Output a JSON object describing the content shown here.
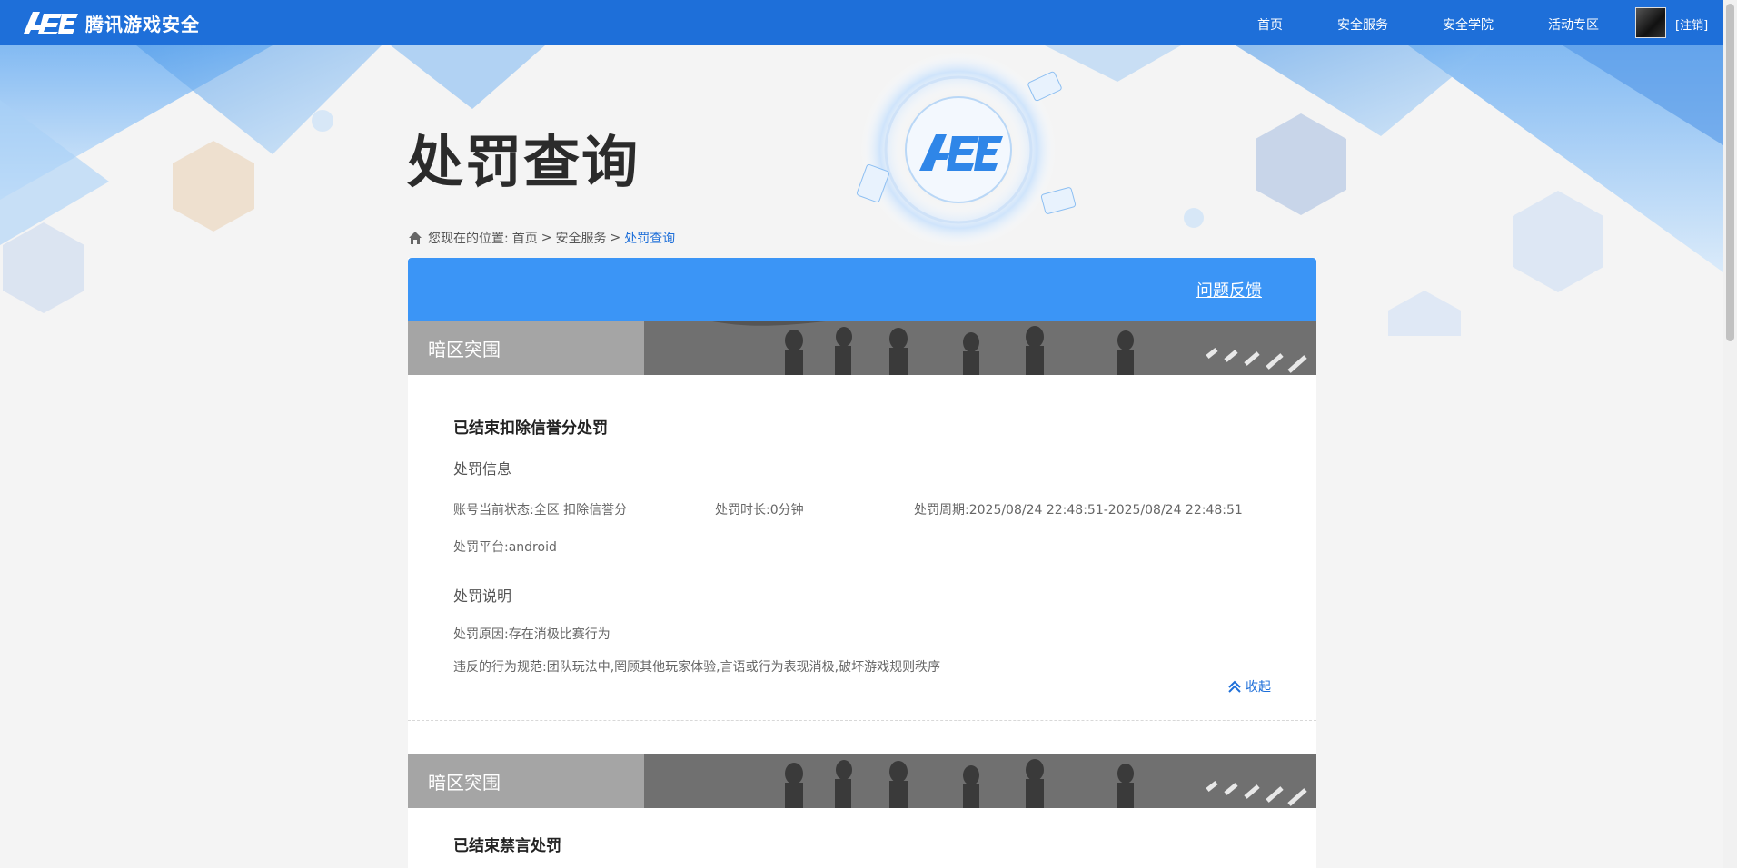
{
  "header": {
    "logo_text": "腾讯游戏安全",
    "nav": [
      {
        "label": "首页"
      },
      {
        "label": "安全服务"
      },
      {
        "label": "安全学院"
      },
      {
        "label": "活动专区"
      }
    ],
    "logout_label": "[注销]"
  },
  "page": {
    "title": "处罚查询",
    "breadcrumb": {
      "prefix": "您现在的位置:",
      "items": [
        "首页",
        "安全服务"
      ],
      "separator": ">",
      "current": "处罚查询"
    }
  },
  "panel": {
    "feedback_label": "问题反馈",
    "records": [
      {
        "game": "暗区突围",
        "title": "已结束扣除信誉分处罚",
        "info_heading": "处罚信息",
        "status": "账号当前状态:全区 扣除信誉分",
        "duration": "处罚时长:0分钟",
        "period": "处罚周期:2025/08/24 22:48:51-2025/08/24 22:48:51",
        "platform": "处罚平台:android",
        "desc_heading": "处罚说明",
        "reason": "处罚原因:存在消极比赛行为",
        "rule": "违反的行为规范:团队玩法中,罔顾其他玩家体验,言语或行为表现消极,破坏游戏规则秩序",
        "collapse_label": "收起"
      },
      {
        "game": "暗区突围",
        "title": "已结束禁言处罚"
      }
    ]
  },
  "colors": {
    "nav_blue": "#1e6fd9",
    "panel_header_blue": "#3b95f6",
    "link_blue": "#1e6fd9"
  }
}
